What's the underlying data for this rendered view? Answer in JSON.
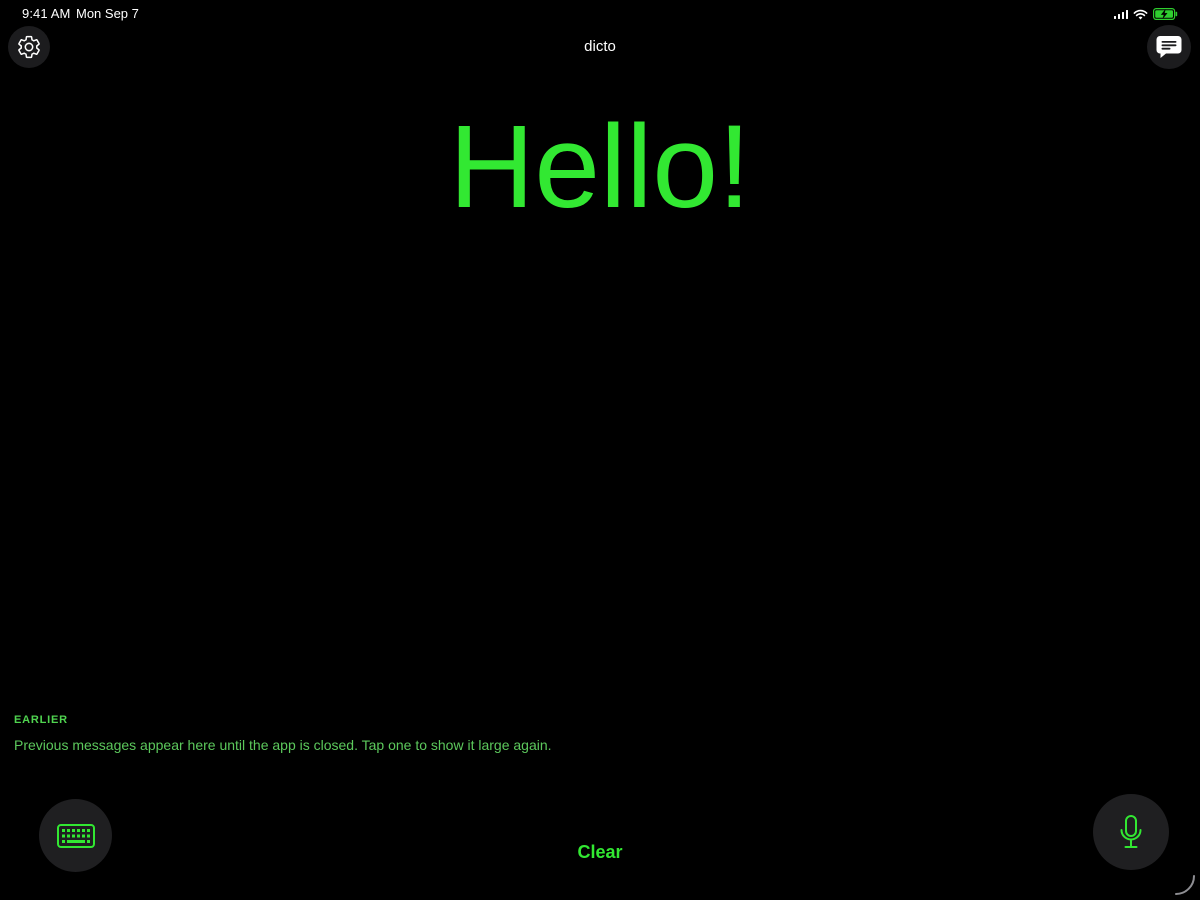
{
  "status_bar": {
    "time": "9:41 AM",
    "date": "Mon Sep 7",
    "icons": [
      "cellular-signal-icon",
      "wifi-icon",
      "battery-charging-icon"
    ]
  },
  "header": {
    "title": "dicto",
    "left_icon": "gear-icon",
    "right_icon": "message-bubble-icon"
  },
  "display": {
    "text": "Hello!"
  },
  "earlier": {
    "label": "EARLIER",
    "description": "Previous messages appear here until the app is closed. Tap one to show it large again."
  },
  "controls": {
    "keyboard_icon": "keyboard-icon",
    "clear_label": "Clear",
    "mic_icon": "microphone-icon"
  },
  "colors": {
    "background": "#000000",
    "accent_green": "#32e832",
    "button_bg": "#1f1f21",
    "text_primary": "#ffffff"
  }
}
